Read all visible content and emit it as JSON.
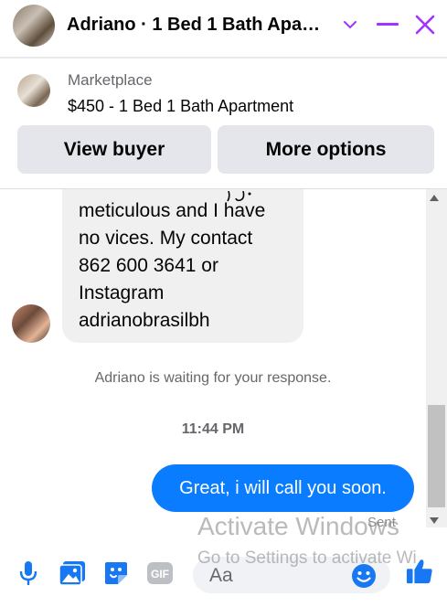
{
  "header": {
    "title": "Adriano · 1 Bed 1 Bath Apa…",
    "accent_color": "#a033ff",
    "icons": [
      "chevron-down-icon",
      "minimize-icon",
      "close-icon"
    ]
  },
  "listing": {
    "label": "Marketplace",
    "title": "$450 - 1 Bed 1 Bath Apartment",
    "buttons": {
      "view_buyer": "View buyer",
      "more_options": "More options"
    }
  },
  "messages": {
    "incoming_lines": [
      "meticulous and I have",
      "no vices. My contact",
      "862 600 3641 or",
      "Instagram",
      "adrianobrasilbh"
    ],
    "waiting_text": "Adriano is waiting for your response.",
    "timestamp": "11:44 PM",
    "outgoing": "Great, i will call you soon.",
    "status": "Sent",
    "outgoing_color": "#0a7cff"
  },
  "composer": {
    "placeholder": "Aa",
    "gif_label": "GIF",
    "icons": [
      "microphone-icon",
      "photo-icon",
      "sticker-icon",
      "gif-icon",
      "emoji-icon",
      "like-icon"
    ],
    "icon_color": "#1877f2"
  },
  "watermark": {
    "line1": "Activate Windows",
    "line2": "Go to Settings to activate Wi"
  }
}
